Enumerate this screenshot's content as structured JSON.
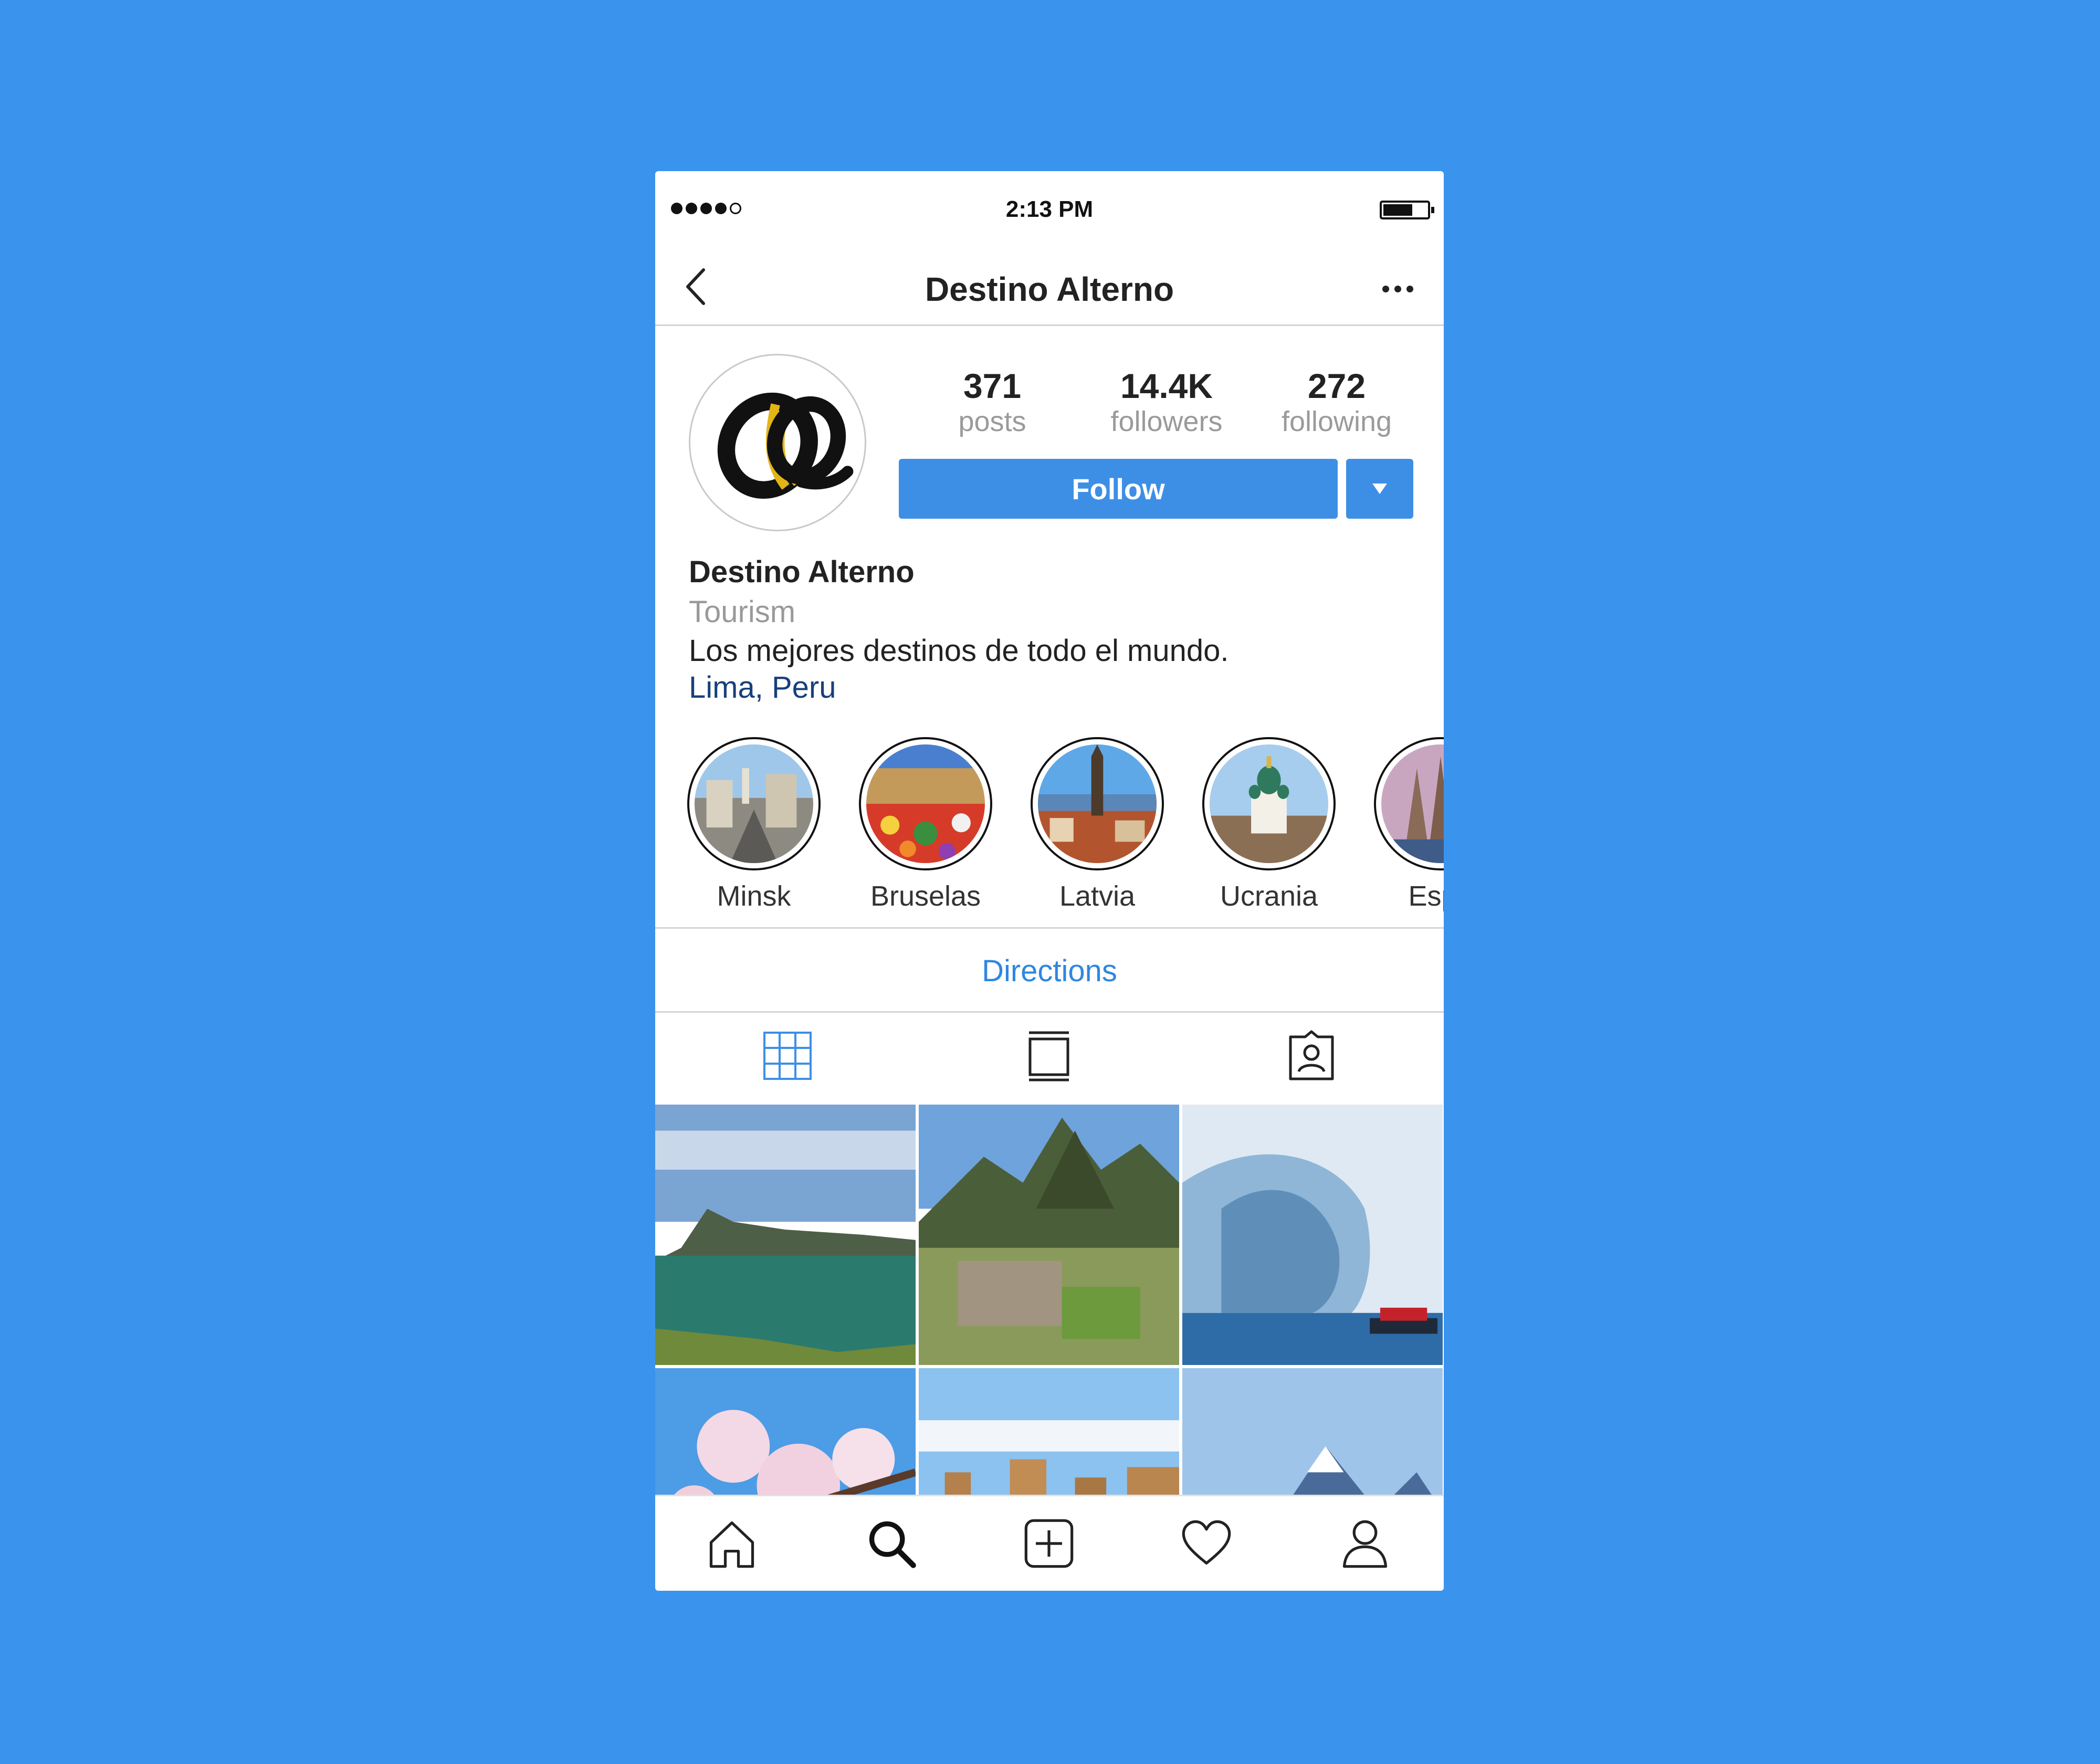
{
  "status_bar": {
    "time": "2:13 PM"
  },
  "nav": {
    "title": "Destino Alterno"
  },
  "profile": {
    "stats": [
      {
        "value": "371",
        "label": "posts"
      },
      {
        "value": "14.4K",
        "label": "followers"
      },
      {
        "value": "272",
        "label": "following"
      }
    ],
    "follow_label": "Follow",
    "name": "Destino Alterno",
    "category": "Tourism",
    "bio": "Los mejores destinos de todo el mundo.",
    "location": "Lima, Peru"
  },
  "highlights": [
    {
      "label": "Minsk"
    },
    {
      "label": "Bruselas"
    },
    {
      "label": "Latvia"
    },
    {
      "label": "Ucrania"
    },
    {
      "label": "Espa"
    }
  ],
  "directions_label": "Directions",
  "colors": {
    "background": "#3a94ee",
    "accent": "#3d8fe6",
    "link": "#2f86e0",
    "location": "#17407a"
  },
  "icons": {
    "profile_tabs": [
      "grid-icon",
      "feed-icon",
      "tagged-icon"
    ],
    "tab_bar": [
      "home-icon",
      "search-icon",
      "add-post-icon",
      "heart-icon",
      "profile-icon"
    ]
  }
}
